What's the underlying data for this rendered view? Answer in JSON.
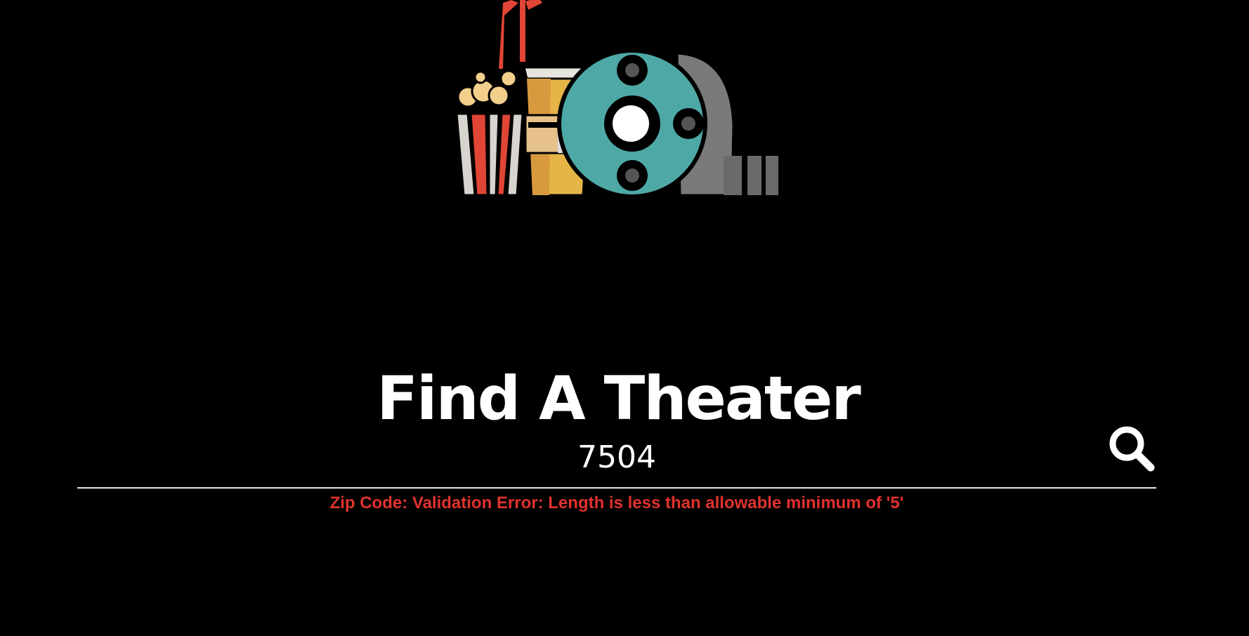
{
  "header": {
    "logo_icon": "movie-theater-logo-icon",
    "title": "Find A Theater"
  },
  "search": {
    "zip_value": "7504",
    "search_icon": "search-icon"
  },
  "validation": {
    "error_message": "Zip Code: Validation Error: Length is less than allowable minimum of '5'",
    "error_color": "#e0322e"
  },
  "colors": {
    "background": "#000000",
    "text": "#ffffff",
    "underline": "#e8e8e8"
  }
}
